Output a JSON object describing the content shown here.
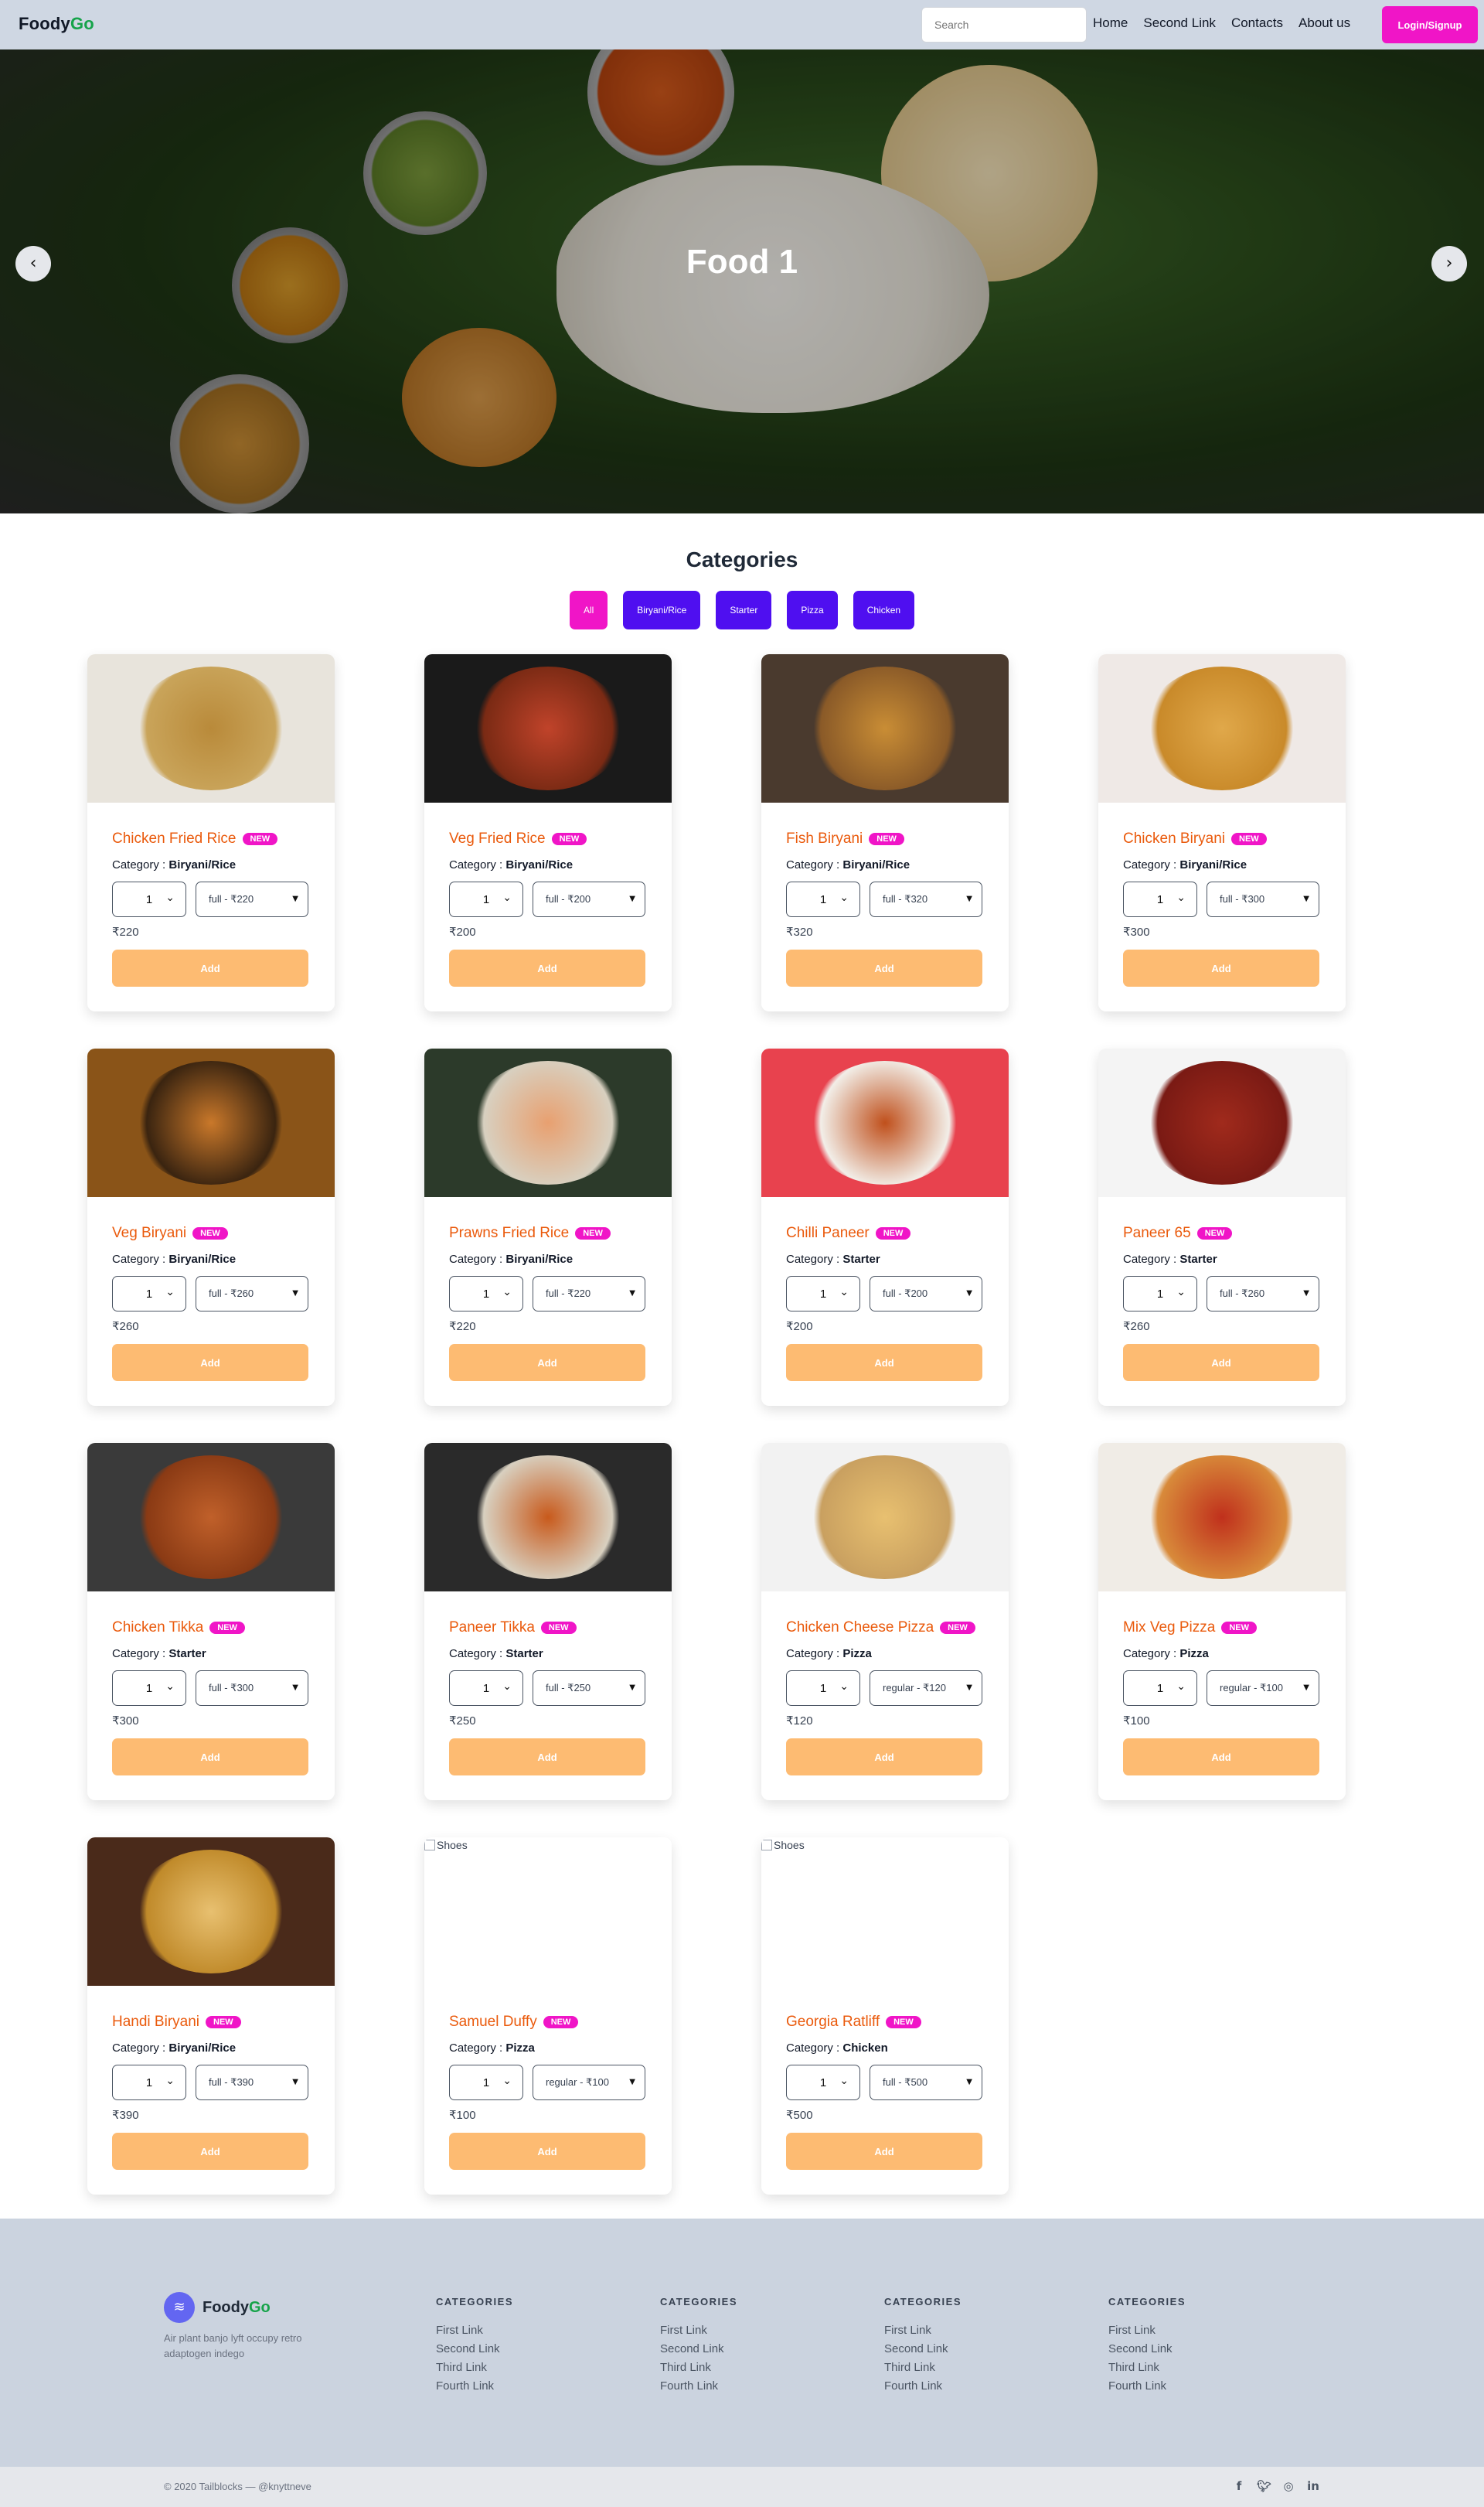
{
  "navbar": {
    "brand_part1": "Foody",
    "brand_part2": "Go",
    "search_placeholder": "Search",
    "links": [
      "Home",
      "Second Link",
      "Contacts",
      "About us"
    ],
    "login_label": "Login/Signup"
  },
  "hero": {
    "title": "Food 1",
    "prev_arrow": "‹",
    "next_arrow": "›"
  },
  "categories": {
    "heading": "Categories",
    "filters": [
      "All",
      "Biryani/Rice",
      "Starter",
      "Pizza",
      "Chicken"
    ],
    "active_filter": "All"
  },
  "card_common": {
    "badge": "NEW",
    "category_prefix": "Category : ",
    "add_label": "Add",
    "qty_default": "1",
    "broken_alt": "Shoes"
  },
  "products": [
    {
      "name": "Chicken Fried Rice",
      "category": "Biryani/Rice",
      "size": "full - ₹220",
      "price": "₹220"
    },
    {
      "name": "Veg Fried Rice",
      "category": "Biryani/Rice",
      "size": "full - ₹200",
      "price": "₹200"
    },
    {
      "name": "Fish Biryani",
      "category": "Biryani/Rice",
      "size": "full - ₹320",
      "price": "₹320"
    },
    {
      "name": "Chicken Biryani",
      "category": "Biryani/Rice",
      "size": "full - ₹300",
      "price": "₹300"
    },
    {
      "name": "Veg Biryani",
      "category": "Biryani/Rice",
      "size": "full - ₹260",
      "price": "₹260"
    },
    {
      "name": "Prawns Fried Rice",
      "category": "Biryani/Rice",
      "size": "full - ₹220",
      "price": "₹220"
    },
    {
      "name": "Chilli Paneer",
      "category": "Starter",
      "size": "full - ₹200",
      "price": "₹200"
    },
    {
      "name": "Paneer 65",
      "category": "Starter",
      "size": "full - ₹260",
      "price": "₹260"
    },
    {
      "name": "Chicken Tikka",
      "category": "Starter",
      "size": "full - ₹300",
      "price": "₹300"
    },
    {
      "name": "Paneer Tikka",
      "category": "Starter",
      "size": "full - ₹250",
      "price": "₹250"
    },
    {
      "name": "Chicken Cheese Pizza",
      "category": "Pizza",
      "size": "regular - ₹120",
      "price": "₹120"
    },
    {
      "name": "Mix Veg Pizza",
      "category": "Pizza",
      "size": "regular - ₹100",
      "price": "₹100"
    },
    {
      "name": "Handi Biryani",
      "category": "Biryani/Rice",
      "size": "full - ₹390",
      "price": "₹390"
    },
    {
      "name": "Samuel Duffy",
      "category": "Pizza",
      "size": "regular - ₹100",
      "price": "₹100"
    },
    {
      "name": "Georgia Ratliff",
      "category": "Chicken",
      "size": "full - ₹500",
      "price": "₹500"
    }
  ],
  "footer": {
    "brand_part1": "Foody",
    "brand_part2": "Go",
    "tagline": "Air plant banjo lyft occupy retro adaptogen indego",
    "columns": [
      {
        "heading": "CATEGORIES",
        "links": [
          "First Link",
          "Second Link",
          "Third Link",
          "Fourth Link"
        ]
      },
      {
        "heading": "CATEGORIES",
        "links": [
          "First Link",
          "Second Link",
          "Third Link",
          "Fourth Link"
        ]
      },
      {
        "heading": "CATEGORIES",
        "links": [
          "First Link",
          "Second Link",
          "Third Link",
          "Fourth Link"
        ]
      },
      {
        "heading": "CATEGORIES",
        "links": [
          "First Link",
          "Second Link",
          "Third Link",
          "Fourth Link"
        ]
      }
    ],
    "copyright": "© 2020 Tailblocks — @knyttneve",
    "socials": [
      "facebook-icon",
      "twitter-icon",
      "instagram-icon",
      "linkedin-icon"
    ]
  },
  "colors": {
    "accent_pink": "#f015c7",
    "accent_purple": "#4f0ff0",
    "title_orange": "#ea5a0c",
    "add_button": "#fdbb72",
    "brand_green": "#16a34a"
  }
}
